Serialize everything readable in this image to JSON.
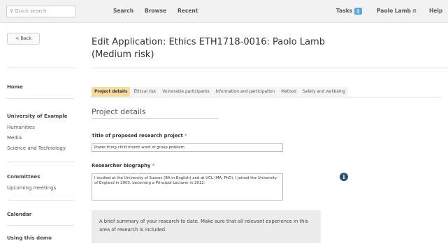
{
  "topbar": {
    "quick_search_placeholder": "Quick search",
    "nav": [
      "Search",
      "Browse",
      "Recent"
    ],
    "tasks_label": "Tasks",
    "tasks_count": "2",
    "user_name": "Paolo Lamb",
    "help_label": "Help"
  },
  "sidebar": {
    "back_label": "< Back",
    "home": "Home",
    "university_heading": "University of Example",
    "university_links": [
      "Humanities",
      "Media",
      "Science and Technology"
    ],
    "committees_heading": "Committees",
    "committees_links": [
      "Upcoming meetings"
    ],
    "calendar": "Calendar",
    "using_demo": "Using this demo"
  },
  "main": {
    "title": "Edit Application: Ethics ETH1718-0016: Paolo Lamb (Medium risk)",
    "tabs": [
      {
        "label": "Project details",
        "active": true
      },
      {
        "label": "Ethical risk",
        "active": false
      },
      {
        "label": "Vulnerable participants",
        "active": false
      },
      {
        "label": "Information and participation",
        "active": false
      },
      {
        "label": "Method",
        "active": false
      },
      {
        "label": "Safety and wellbeing",
        "active": false
      }
    ],
    "section_heading": "Project details",
    "title_field_label": "Title of proposed research project",
    "title_field_value": "Power thing child month word of group problem",
    "bio_field_label": "Researcher biography",
    "bio_field_value": "I studied at the University of Sussex (BA in English) and at UCL (MA, PhD). I joined the University of England in 2003, becoming a Principal Lecturer in 2012.",
    "required_marker": "*",
    "info_icon_glyph": "i",
    "help_text": "A brief summary of your research to date. Make sure that all relevant experience in this area of research is included."
  },
  "colors": {
    "active_tab": "#f6dca0",
    "tasks_badge": "#5aa7de",
    "info_icon": "#2e4f72"
  }
}
